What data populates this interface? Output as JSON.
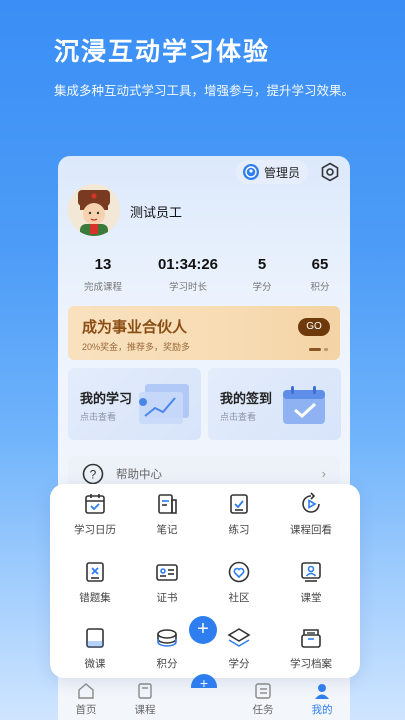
{
  "hero": {
    "title": "沉浸互动学习体验",
    "subtitle": "集成多种互动式学习工具，增强参与，提升学习效果。"
  },
  "header": {
    "admin_label": "管理员"
  },
  "user": {
    "name": "测试员工"
  },
  "stats": [
    {
      "value": "13",
      "label": "完成课程"
    },
    {
      "value": "01:34:26",
      "label": "学习时长"
    },
    {
      "value": "5",
      "label": "学分"
    },
    {
      "value": "65",
      "label": "积分"
    }
  ],
  "banner": {
    "title": "成为事业合伙人",
    "subtitle": "20%奖金，推荐多，奖励多",
    "go_label": "GO"
  },
  "cards": [
    {
      "title": "我的学习",
      "subtitle": "点击查看"
    },
    {
      "title": "我的签到",
      "subtitle": "点击查看"
    }
  ],
  "help": {
    "label": "帮助中心",
    "arrow": "›"
  },
  "grid": [
    {
      "label": "学习日历",
      "icon": "calendar-icon"
    },
    {
      "label": "笔记",
      "icon": "notes-icon"
    },
    {
      "label": "练习",
      "icon": "practice-icon"
    },
    {
      "label": "课程回看",
      "icon": "replay-icon"
    },
    {
      "label": "错题集",
      "icon": "mistakes-icon"
    },
    {
      "label": "证书",
      "icon": "certificate-icon"
    },
    {
      "label": "社区",
      "icon": "community-icon"
    },
    {
      "label": "课堂",
      "icon": "classroom-icon"
    },
    {
      "label": "微课",
      "icon": "microcourse-icon"
    },
    {
      "label": "积分",
      "icon": "points-icon"
    },
    {
      "label": "学分",
      "icon": "credits-icon"
    },
    {
      "label": "学习档案",
      "icon": "archive-icon"
    }
  ],
  "fab": {
    "symbol": "+"
  },
  "tabs": [
    {
      "label": "首页",
      "icon": "home-icon"
    },
    {
      "label": "课程",
      "icon": "course-icon"
    },
    {
      "label": "任务",
      "icon": "task-icon"
    },
    {
      "label": "我的",
      "icon": "profile-icon",
      "active": true
    }
  ],
  "colors": {
    "primary": "#2f7ef0",
    "banner_text": "#8a4d14",
    "hero_bg": "#3a8ef5"
  }
}
